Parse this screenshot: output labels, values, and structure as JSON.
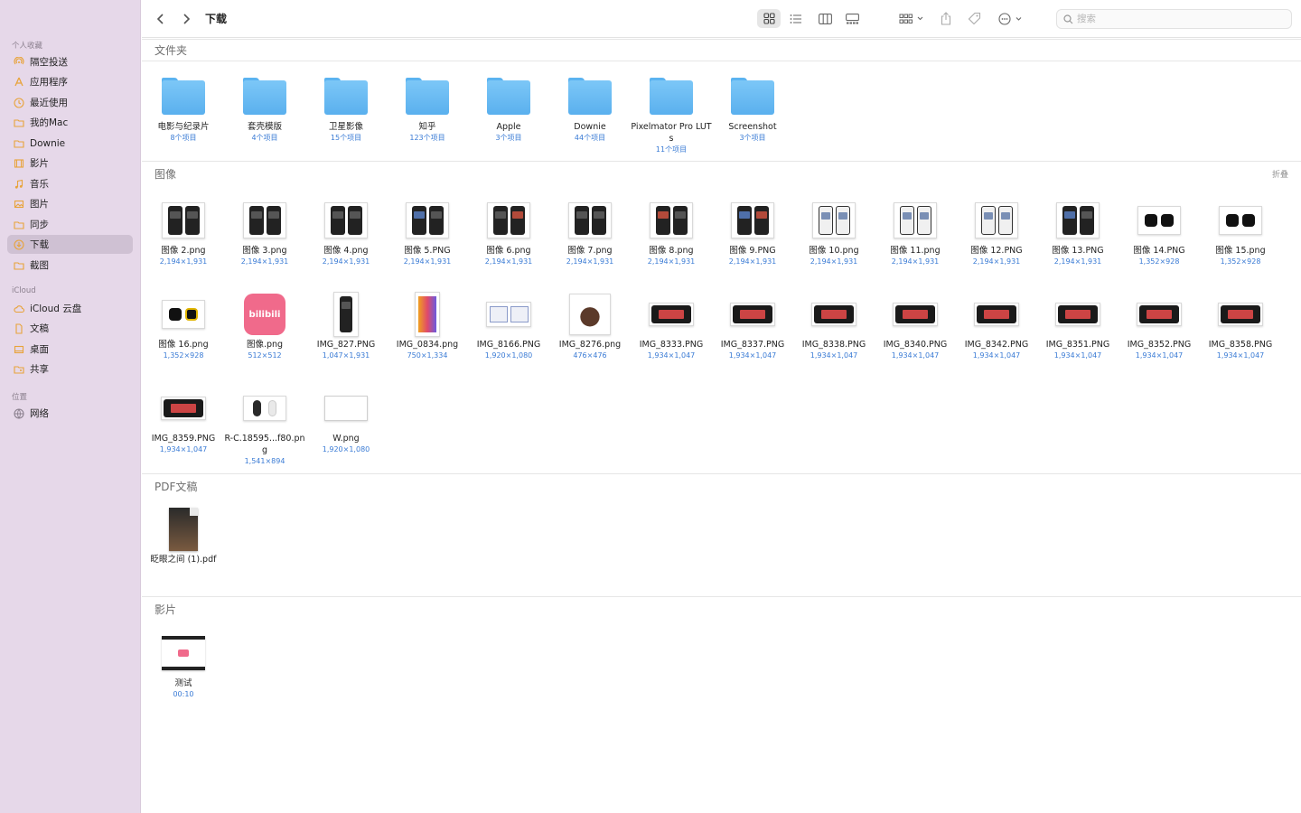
{
  "window": {
    "title": "下载"
  },
  "sidebar": {
    "sections": [
      {
        "label": "个人收藏",
        "items": [
          {
            "label": "隔空投送",
            "icon": "airdrop-icon"
          },
          {
            "label": "应用程序",
            "icon": "applications-icon"
          },
          {
            "label": "最近使用",
            "icon": "clock-icon"
          },
          {
            "label": "我的Mac",
            "icon": "folder-icon"
          },
          {
            "label": "Downie",
            "icon": "folder-icon"
          },
          {
            "label": "影片",
            "icon": "film-icon"
          },
          {
            "label": "音乐",
            "icon": "music-icon"
          },
          {
            "label": "图片",
            "icon": "photo-icon"
          },
          {
            "label": "同步",
            "icon": "folder-icon"
          },
          {
            "label": "下载",
            "icon": "download-icon",
            "selected": true
          },
          {
            "label": "截图",
            "icon": "folder-icon"
          }
        ]
      },
      {
        "label": "iCloud",
        "items": [
          {
            "label": "iCloud 云盘",
            "icon": "cloud-icon"
          },
          {
            "label": "文稿",
            "icon": "document-icon"
          },
          {
            "label": "桌面",
            "icon": "desktop-icon"
          },
          {
            "label": "共享",
            "icon": "shared-folder-icon"
          }
        ]
      },
      {
        "label": "位置",
        "items": [
          {
            "label": "网络",
            "icon": "network-icon"
          }
        ]
      }
    ]
  },
  "toolbar": {
    "search_placeholder": "搜索"
  },
  "groups": {
    "folders": {
      "title": "文件夹",
      "items": [
        {
          "name": "电影与纪录片",
          "sub": "8个项目"
        },
        {
          "name": "套壳模版",
          "sub": "4个项目"
        },
        {
          "name": "卫星影像",
          "sub": "15个项目"
        },
        {
          "name": "知乎",
          "sub": "123个项目"
        },
        {
          "name": "Apple",
          "sub": "3个项目"
        },
        {
          "name": "Downie",
          "sub": "44个项目"
        },
        {
          "name": "Pixelmator Pro LUTs",
          "sub": "11个项目"
        },
        {
          "name": "Screenshot",
          "sub": "3个项目"
        }
      ]
    },
    "images": {
      "title": "图像",
      "collapse_label": "折叠",
      "items": [
        {
          "name": "图像 2.png",
          "sub": "2,194×1,931"
        },
        {
          "name": "图像 3.png",
          "sub": "2,194×1,931"
        },
        {
          "name": "图像 4.png",
          "sub": "2,194×1,931"
        },
        {
          "name": "图像 5.PNG",
          "sub": "2,194×1,931"
        },
        {
          "name": "图像 6.png",
          "sub": "2,194×1,931"
        },
        {
          "name": "图像 7.png",
          "sub": "2,194×1,931"
        },
        {
          "name": "图像 8.png",
          "sub": "2,194×1,931"
        },
        {
          "name": "图像 9.PNG",
          "sub": "2,194×1,931"
        },
        {
          "name": "图像 10.png",
          "sub": "2,194×1,931"
        },
        {
          "name": "图像 11.png",
          "sub": "2,194×1,931"
        },
        {
          "name": "图像 12.PNG",
          "sub": "2,194×1,931"
        },
        {
          "name": "图像 13.PNG",
          "sub": "2,194×1,931"
        },
        {
          "name": "图像 14.PNG",
          "sub": "1,352×928"
        },
        {
          "name": "图像 15.png",
          "sub": "1,352×928"
        },
        {
          "name": "图像 16.png",
          "sub": "1,352×928"
        },
        {
          "name": "图像.png",
          "sub": "512×512"
        },
        {
          "name": "IMG_827.PNG",
          "sub": "1,047×1,931"
        },
        {
          "name": "IMG_0834.png",
          "sub": "750×1,334"
        },
        {
          "name": "IMG_8166.PNG",
          "sub": "1,920×1,080"
        },
        {
          "name": "IMG_8276.png",
          "sub": "476×476"
        },
        {
          "name": "IMG_8333.PNG",
          "sub": "1,934×1,047"
        },
        {
          "name": "IMG_8337.PNG",
          "sub": "1,934×1,047"
        },
        {
          "name": "IMG_8338.PNG",
          "sub": "1,934×1,047"
        },
        {
          "name": "IMG_8340.PNG",
          "sub": "1,934×1,047"
        },
        {
          "name": "IMG_8342.PNG",
          "sub": "1,934×1,047"
        },
        {
          "name": "IMG_8351.PNG",
          "sub": "1,934×1,047"
        },
        {
          "name": "IMG_8352.PNG",
          "sub": "1,934×1,047"
        },
        {
          "name": "IMG_8358.PNG",
          "sub": "1,934×1,047"
        },
        {
          "name": "IMG_8359.PNG",
          "sub": "1,934×1,047"
        },
        {
          "name": "R-C.18595...f80.png",
          "sub": "1,541×894"
        },
        {
          "name": "W.png",
          "sub": "1,920×1,080"
        }
      ]
    },
    "pdfs": {
      "title": "PDF文稿",
      "items": [
        {
          "name": "眨眼之间 (1).pdf",
          "sub": ""
        }
      ]
    },
    "movies": {
      "title": "影片",
      "items": [
        {
          "name": "测试",
          "sub": "00:10"
        }
      ]
    }
  },
  "colors": {
    "sidebar_bg": "#e6d8e9",
    "selected_bg": "#cfc1d3",
    "folder_blue": "#6bbcf3",
    "link_blue": "#3a7bd5",
    "sidebar_icon": "#e8a33a"
  }
}
